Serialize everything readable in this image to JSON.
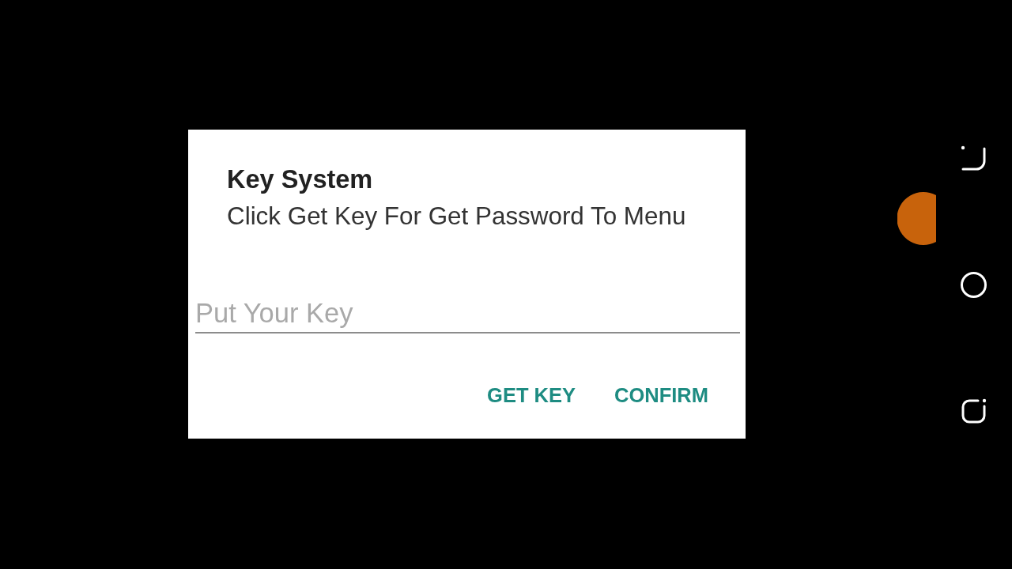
{
  "dialog": {
    "title": "Key System",
    "message": "Click Get Key For Get Password To Menu",
    "key_field": {
      "placeholder": "Put Your Key"
    },
    "buttons": [
      {
        "label": "GET KEY"
      },
      {
        "label": "CONFIRM"
      }
    ]
  },
  "nav_bar": {
    "buttons": [
      {
        "kind": "back"
      },
      {
        "kind": "home"
      },
      {
        "kind": "recents"
      }
    ]
  }
}
